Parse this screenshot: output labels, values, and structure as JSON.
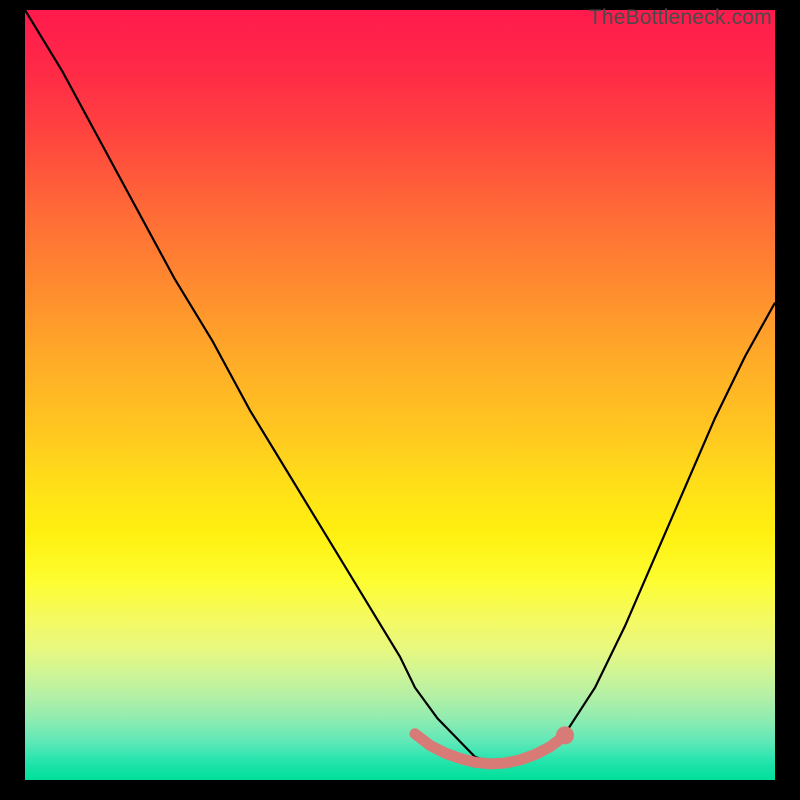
{
  "watermark": "TheBottleneck.com",
  "chart_data": {
    "type": "line",
    "title": "",
    "xlabel": "",
    "ylabel": "",
    "xlim": [
      0,
      100
    ],
    "ylim": [
      0,
      100
    ],
    "background": "traffic-light-gradient (red top → green bottom)",
    "series": [
      {
        "name": "bottleneck-curve",
        "style": "thin-black",
        "x": [
          0,
          5,
          10,
          15,
          20,
          25,
          30,
          35,
          40,
          45,
          50,
          52,
          55,
          58,
          60,
          63,
          65,
          68,
          72,
          76,
          80,
          84,
          88,
          92,
          96,
          100
        ],
        "y": [
          100,
          92,
          83,
          74,
          65,
          57,
          48,
          40,
          32,
          24,
          16,
          12,
          8,
          5,
          3,
          2,
          2,
          3,
          6,
          12,
          20,
          29,
          38,
          47,
          55,
          62
        ]
      },
      {
        "name": "optimal-zone-highlight",
        "style": "thick-salmon",
        "x": [
          52,
          54,
          56,
          58,
          60,
          62,
          64,
          66,
          68,
          70,
          72
        ],
        "y": [
          6,
          4.5,
          3.5,
          2.8,
          2.3,
          2.1,
          2.2,
          2.6,
          3.3,
          4.3,
          5.8
        ]
      }
    ],
    "markers": [
      {
        "name": "optimal-point",
        "x": 72,
        "y": 5.8,
        "color": "#d87a75",
        "size": 9
      }
    ]
  }
}
